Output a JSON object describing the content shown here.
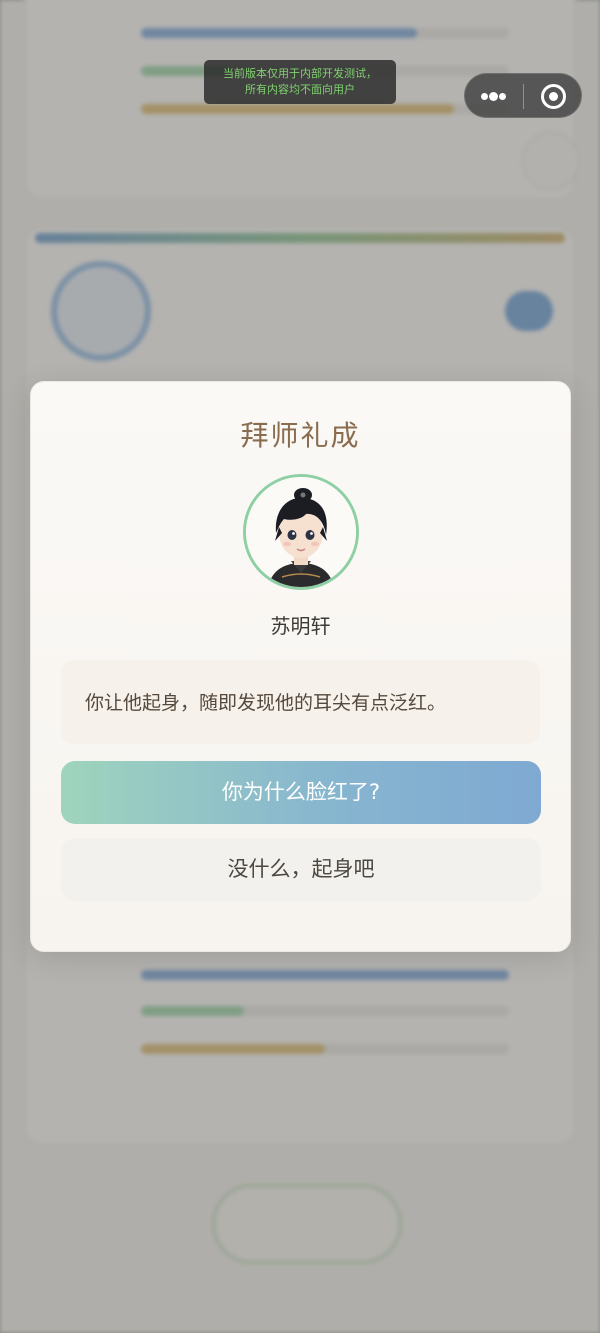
{
  "dev_notice": {
    "line1": "当前版本仅用于内部开发测试，",
    "line2": "所有内容均不面向用户"
  },
  "capsule": {
    "more_icon": "more-dots-icon",
    "close_icon": "target-close-icon"
  },
  "modal": {
    "title": "拜师礼成",
    "character_name": "苏明轩",
    "story_text": "你让他起身，随即发现他的耳尖有点泛红。",
    "choices": [
      {
        "label": "你为什么脸红了?"
      },
      {
        "label": "没什么，起身吧"
      }
    ]
  },
  "colors": {
    "title": "#8a6c4e",
    "primary_gradient_start": "#9fd4bc",
    "primary_gradient_end": "#7fa9d2",
    "portrait_border": "#8fcfa4",
    "dev_notice_text": "#7fd36e"
  }
}
